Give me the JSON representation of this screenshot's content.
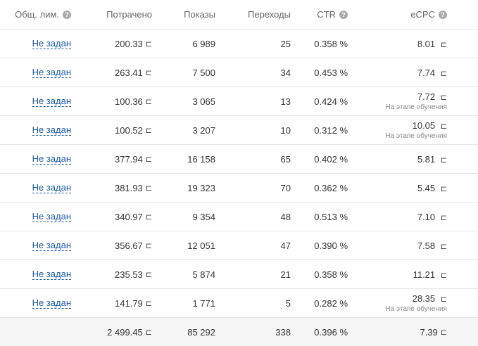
{
  "currency_symbol": "⊏",
  "header": {
    "limit": "Общ. лим.",
    "spent": "Потрачено",
    "shows": "Показы",
    "clicks": "Переходы",
    "ctr": "CTR",
    "ecpc": "eCPC",
    "help": "?"
  },
  "rows": [
    {
      "limit": "Не задан",
      "spent": "200.33",
      "shows": "6 989",
      "clicks": "25",
      "ctr": "0.358 %",
      "ecpc": "8.01",
      "note": ""
    },
    {
      "limit": "Не задан",
      "spent": "263.41",
      "shows": "7 500",
      "clicks": "34",
      "ctr": "0.453 %",
      "ecpc": "7.74",
      "note": ""
    },
    {
      "limit": "Не задан",
      "spent": "100.36",
      "shows": "3 065",
      "clicks": "13",
      "ctr": "0.424 %",
      "ecpc": "7.72",
      "note": "На этапе обучения"
    },
    {
      "limit": "Не задан",
      "spent": "100.52",
      "shows": "3 207",
      "clicks": "10",
      "ctr": "0.312 %",
      "ecpc": "10.05",
      "note": "На этапе обучения"
    },
    {
      "limit": "Не задан",
      "spent": "377.94",
      "shows": "16 158",
      "clicks": "65",
      "ctr": "0.402 %",
      "ecpc": "5.81",
      "note": ""
    },
    {
      "limit": "Не задан",
      "spent": "381.93",
      "shows": "19 323",
      "clicks": "70",
      "ctr": "0.362 %",
      "ecpc": "5.45",
      "note": ""
    },
    {
      "limit": "Не задан",
      "spent": "340.97",
      "shows": "9 354",
      "clicks": "48",
      "ctr": "0.513 %",
      "ecpc": "7.10",
      "note": ""
    },
    {
      "limit": "Не задан",
      "spent": "356.67",
      "shows": "12 051",
      "clicks": "47",
      "ctr": "0.390 %",
      "ecpc": "7.58",
      "note": ""
    },
    {
      "limit": "Не задан",
      "spent": "235.53",
      "shows": "5 874",
      "clicks": "21",
      "ctr": "0.358 %",
      "ecpc": "11.21",
      "note": ""
    },
    {
      "limit": "Не задан",
      "spent": "141.79",
      "shows": "1 771",
      "clicks": "5",
      "ctr": "0.282 %",
      "ecpc": "28.35",
      "note": "На этапе обучения"
    }
  ],
  "total": {
    "spent": "2 499.45",
    "shows": "85 292",
    "clicks": "338",
    "ctr": "0.396 %",
    "ecpc": "7.39"
  }
}
